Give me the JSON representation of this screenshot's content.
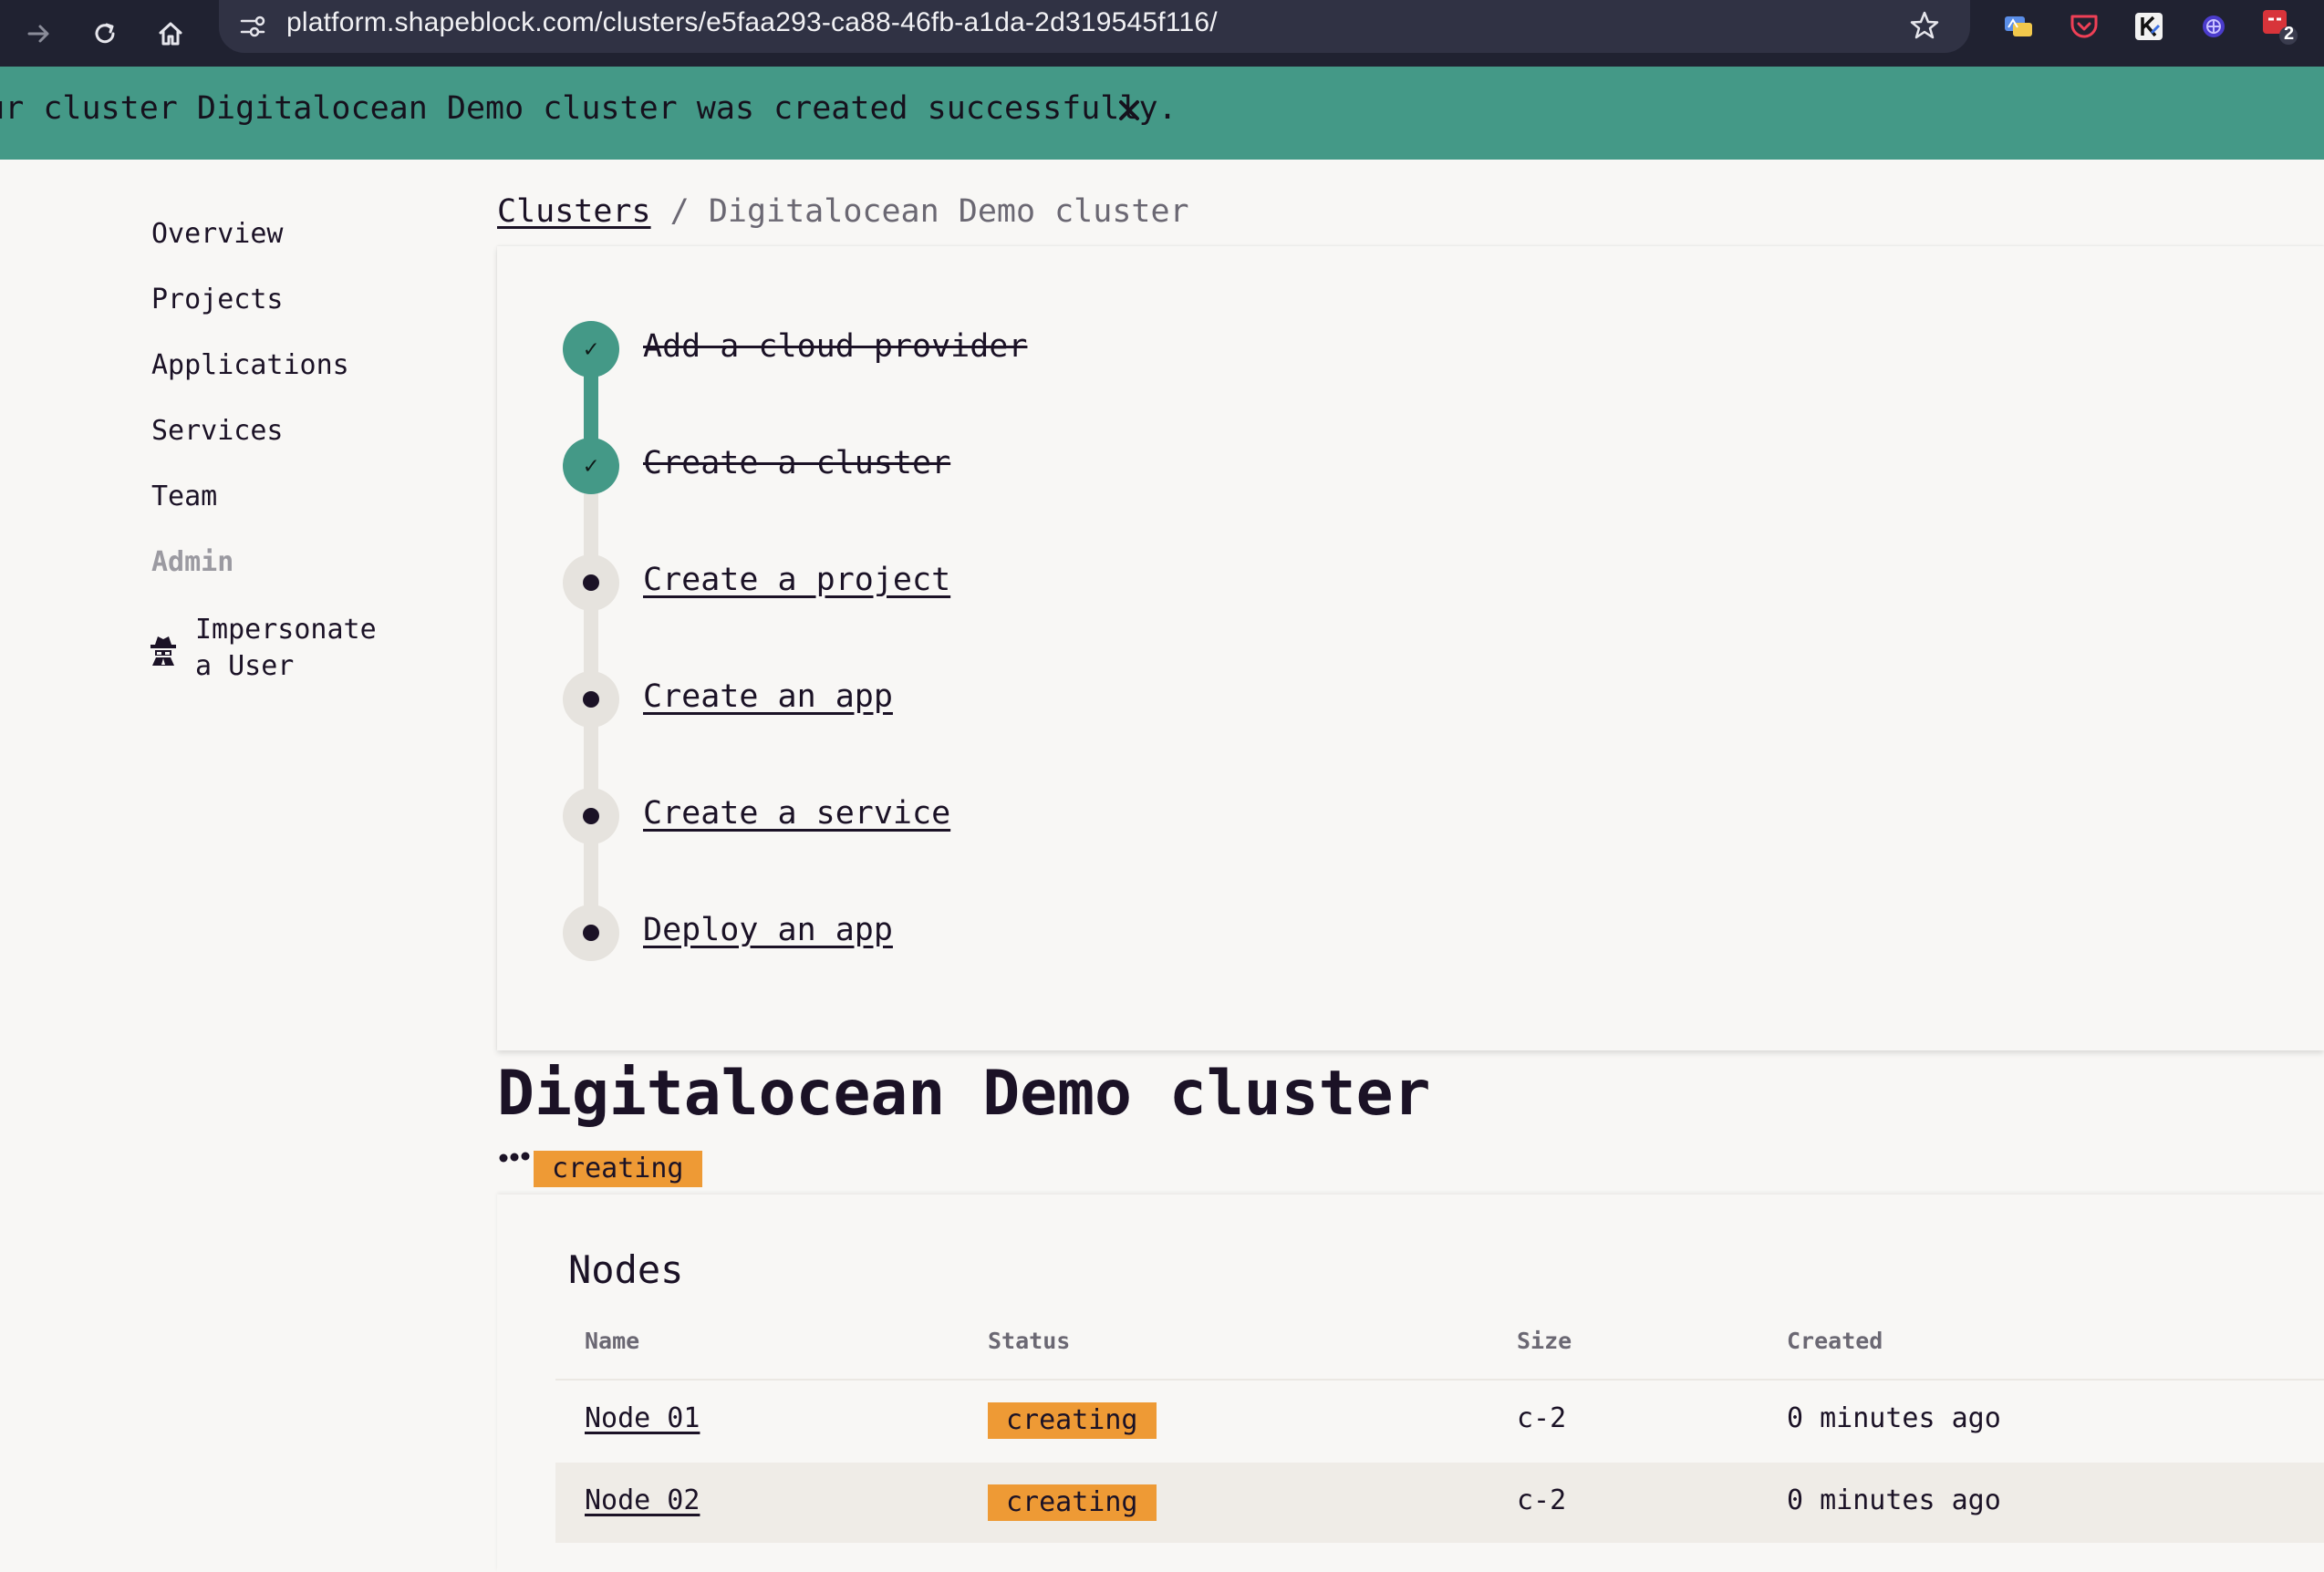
{
  "browser": {
    "url": "platform.shapeblock.com/clusters/e5faa293-ca88-46fb-a1da-2d319545f116/",
    "extension_badge": "2"
  },
  "banner": {
    "message": "Your cluster Digitalocean Demo cluster was created successfully."
  },
  "sidebar": {
    "items": [
      {
        "label": "Overview"
      },
      {
        "label": "Projects"
      },
      {
        "label": "Applications"
      },
      {
        "label": "Services"
      },
      {
        "label": "Team"
      }
    ],
    "admin_heading": "Admin",
    "impersonate_line1": "Impersonate",
    "impersonate_line2": "a User"
  },
  "breadcrumb": {
    "root": "Clusters",
    "separator": "/",
    "current": "Digitalocean Demo cluster"
  },
  "checklist": {
    "steps": [
      {
        "label": "Add a cloud provider",
        "done": true
      },
      {
        "label": "Create a cluster",
        "done": true
      },
      {
        "label": "Create a project",
        "done": false
      },
      {
        "label": "Create an app",
        "done": false
      },
      {
        "label": "Create a service",
        "done": false
      },
      {
        "label": "Deploy an app",
        "done": false
      }
    ]
  },
  "cluster": {
    "title": "Digitalocean Demo cluster",
    "status": "creating"
  },
  "nodes": {
    "title": "Nodes",
    "columns": [
      "Name",
      "Status",
      "Size",
      "Created"
    ],
    "rows": [
      {
        "name": "Node 01",
        "status": "creating",
        "size": "c-2",
        "created": "0 minutes ago"
      },
      {
        "name": "Node 02",
        "status": "creating",
        "size": "c-2",
        "created": "0 minutes ago"
      }
    ]
  },
  "colors": {
    "accent": "#449987",
    "status_creating": "#ee9a35",
    "text": "#1b1226"
  }
}
